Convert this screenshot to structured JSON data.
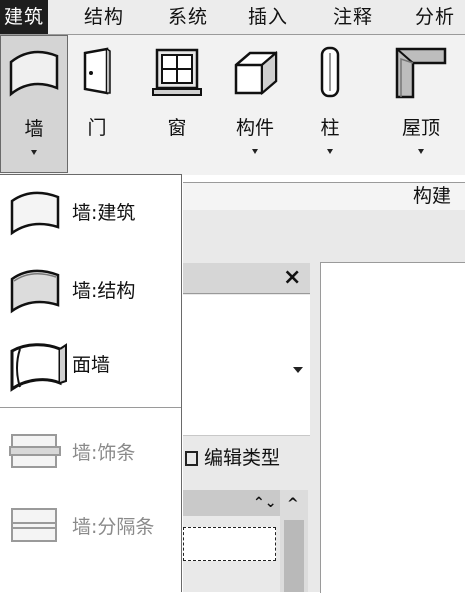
{
  "ribbon_tabs": [
    "建筑",
    "结构",
    "系统",
    "插入",
    "注释",
    "分析"
  ],
  "ribbon_buttons": {
    "wall": "墙",
    "door": "门",
    "window": "窗",
    "component": "构件",
    "column": "柱",
    "roof": "屋顶"
  },
  "panel_label": "构建",
  "wall_menu": {
    "architectural": "墙:建筑",
    "structural": "墙:结构",
    "face": "面墙",
    "sweep": "墙:饰条",
    "reveal": "墙:分隔条"
  },
  "properties": {
    "close_glyph": "×",
    "edit_type": "编辑类型",
    "collapse_glyph": "⌃⌄",
    "scroll_up_glyph": "^"
  },
  "icons": {
    "wall": "wall-icon",
    "door": "door-icon",
    "window": "window-icon",
    "component": "component-icon",
    "column": "column-icon",
    "roof": "roof-icon",
    "face_wall": "face-wall-icon",
    "wall_sweep": "wall-sweep-icon",
    "wall_reveal": "wall-reveal-icon",
    "edit_type": "edit-type-icon"
  }
}
